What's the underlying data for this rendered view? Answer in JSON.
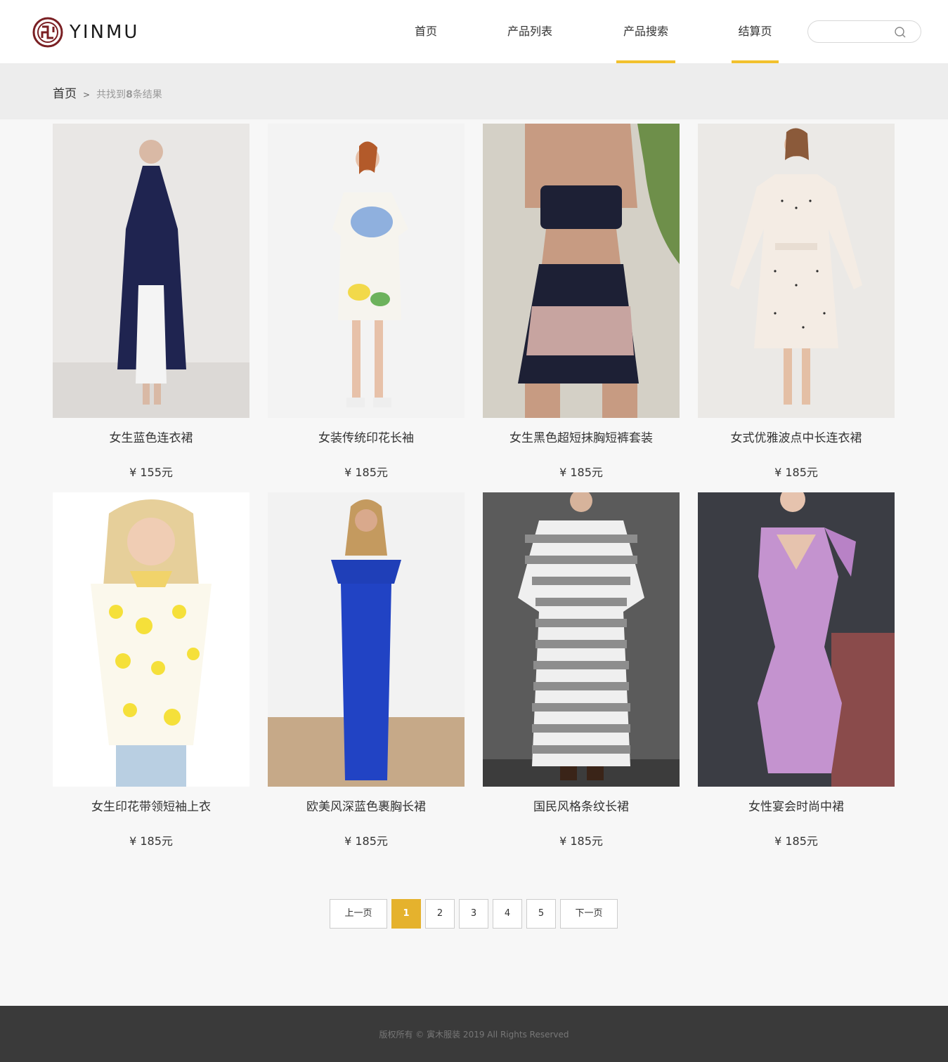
{
  "brand": {
    "name": "YINMU"
  },
  "nav": [
    {
      "label": "首页",
      "active": false
    },
    {
      "label": "产品列表",
      "active": false
    },
    {
      "label": "产品搜索",
      "active": true
    },
    {
      "label": "结算页",
      "active": true
    }
  ],
  "search": {
    "placeholder": "",
    "value": ""
  },
  "breadcrumb": {
    "home": "首页",
    "separator": ">",
    "prefix": "共找到",
    "count": "8",
    "suffix": "条结果"
  },
  "products": [
    {
      "name": "女生蓝色连衣裙",
      "price": "¥ 155元",
      "image": "navy sleeveless pleated long dress on model"
    },
    {
      "name": "女装传统印花长袖",
      "price": "¥ 185元",
      "image": "white watercolor print tunic dress on model"
    },
    {
      "name": "女生黑色超短抹胸短裤套装",
      "price": "¥ 185元",
      "image": "black bandeau top and printed shorts set"
    },
    {
      "name": "女式优雅波点中长连衣裙",
      "price": "¥ 185元",
      "image": "white polka dot long sleeve midi dress"
    },
    {
      "name": "女生印花带领短袖上衣",
      "price": "¥ 185元",
      "image": "yellow floral sleeveless collared top"
    },
    {
      "name": "欧美风深蓝色裹胸长裙",
      "price": "¥ 185元",
      "image": "royal blue strapless maxi dress"
    },
    {
      "name": "国民风格条纹长裙",
      "price": "¥ 185元",
      "image": "grey and white striped loose long dress"
    },
    {
      "name": "女性宴会时尚中裙",
      "price": "¥ 185元",
      "image": "lilac bodycon cold shoulder midi dress"
    }
  ],
  "pagination": {
    "prev": "上一页",
    "pages": [
      "1",
      "2",
      "3",
      "4",
      "5"
    ],
    "current": "1",
    "next": "下一页"
  },
  "footer": {
    "text": "版权所有 © 寅木服装 2019 All Rights Reserved"
  },
  "colors": {
    "accent": "#f2c12e",
    "page_active": "#e5b22d",
    "footer_bg": "#3a3a3a",
    "logo": "#7a1f23"
  }
}
